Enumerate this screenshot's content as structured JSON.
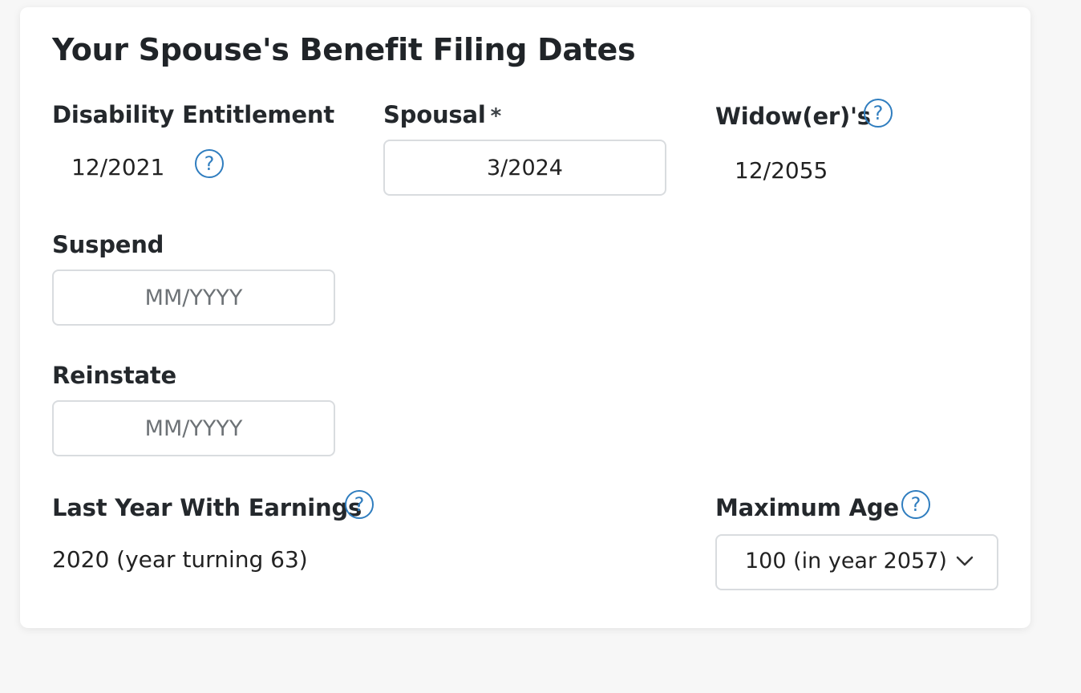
{
  "title": "Your Spouse's Benefit Filing Dates",
  "disability": {
    "label": "Disability Entitlement",
    "value": "12/2021"
  },
  "spousal": {
    "label": "Spousal",
    "required_mark": "*",
    "value": "3/2024"
  },
  "widow": {
    "label": "Widow(er)'s",
    "value": "12/2055"
  },
  "suspend": {
    "label": "Suspend",
    "value": "",
    "placeholder": "MM/YYYY"
  },
  "reinstate": {
    "label": "Reinstate",
    "value": "",
    "placeholder": "MM/YYYY"
  },
  "last_year": {
    "label": "Last Year With Earnings",
    "value": "2020 (year turning 63)"
  },
  "max_age": {
    "label": "Maximum Age",
    "selected": "100 (in year 2057)"
  },
  "help_glyph": "?",
  "colors": {
    "accent": "#2f7dbf",
    "border": "#d9dcdf",
    "text": "#222222"
  },
  "icons": {
    "help": "question-circle-icon",
    "dropdown": "chevron-down-icon"
  }
}
